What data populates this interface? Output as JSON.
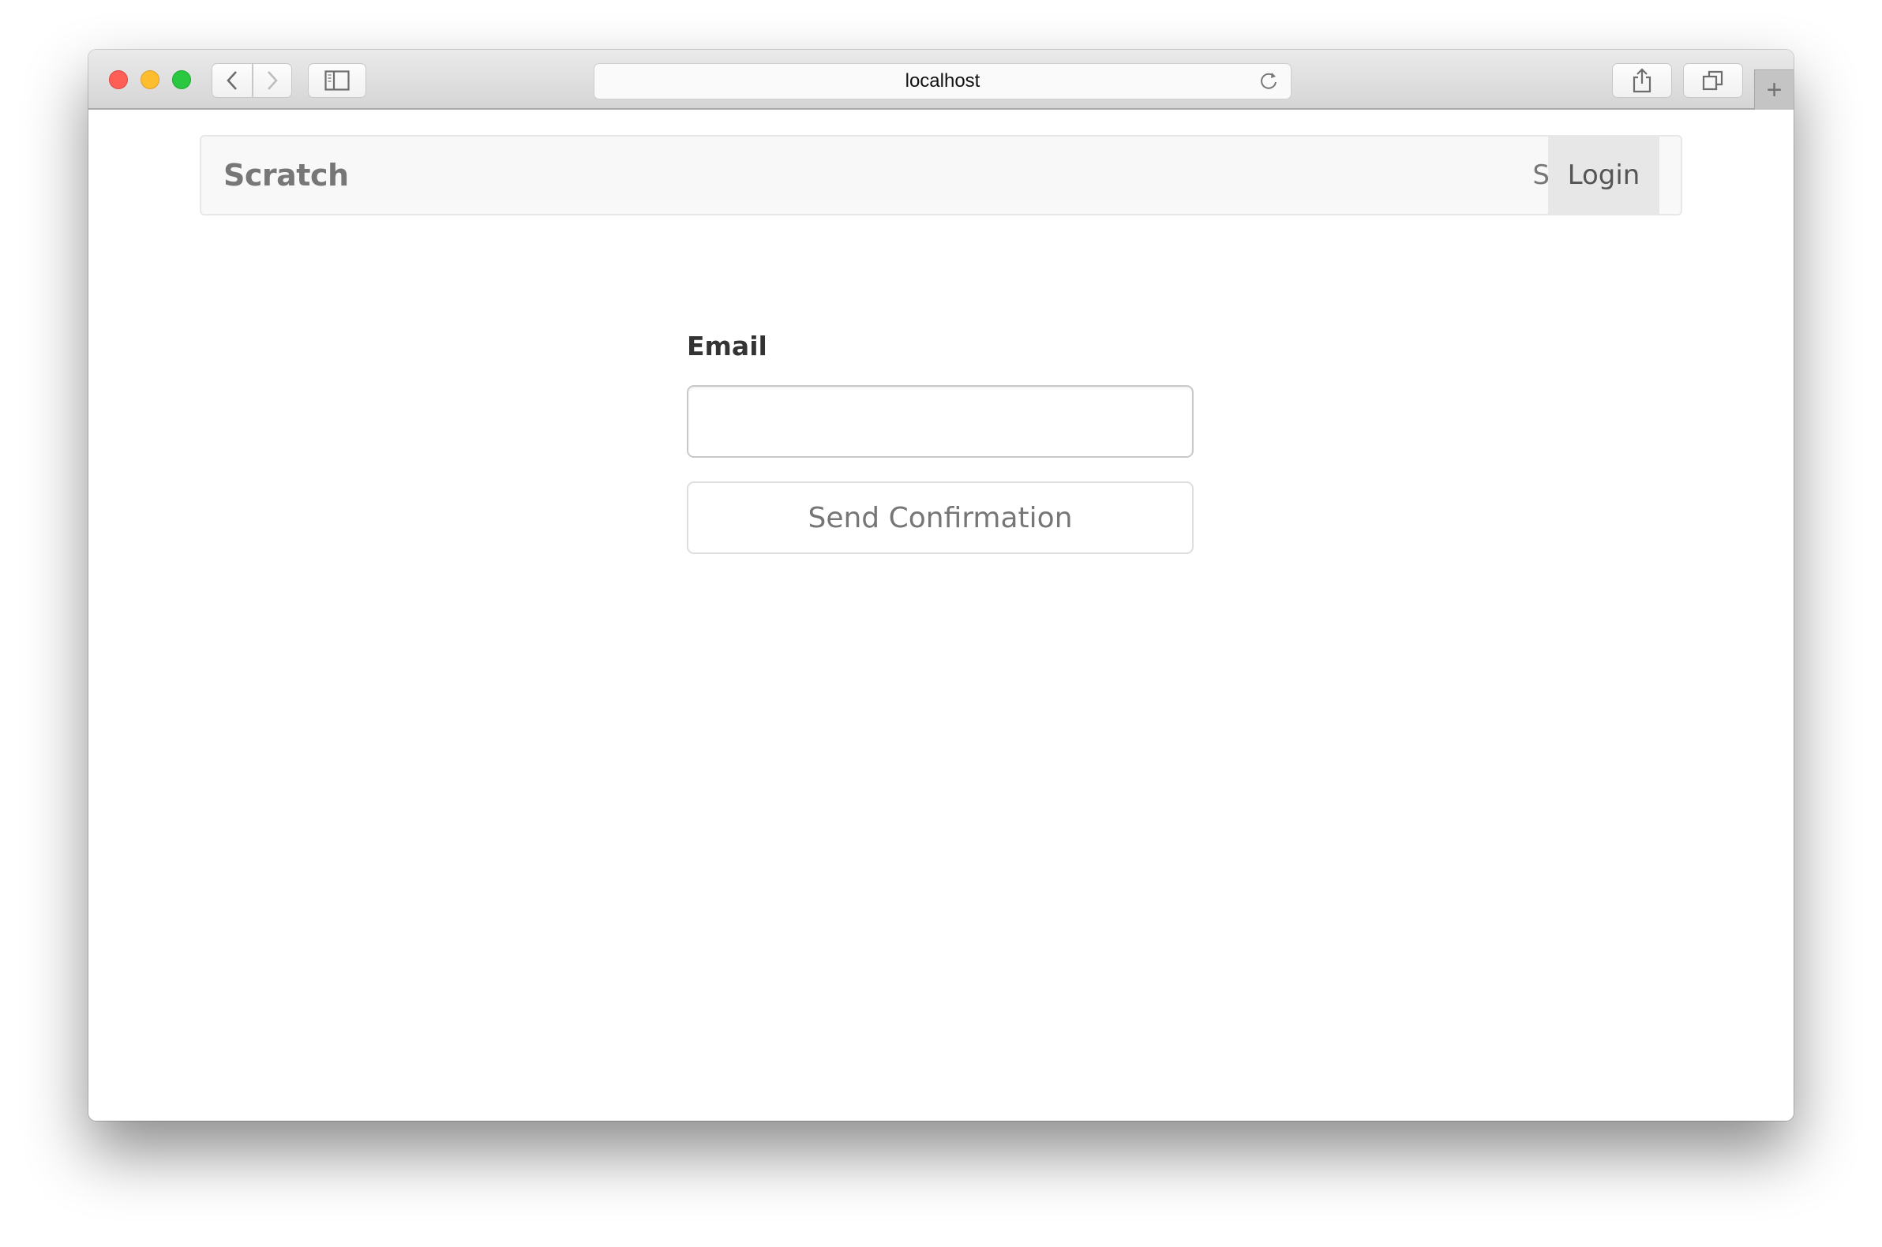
{
  "browser": {
    "url": "localhost",
    "icons": {
      "close": "close-light-icon",
      "minimize": "minimize-light-icon",
      "maximize": "maximize-light-icon",
      "back": "chevron-left-icon",
      "forward": "chevron-right-icon",
      "sidebar": "sidebar-icon",
      "reload": "reload-icon",
      "share": "share-icon",
      "tabs": "tabs-overview-icon",
      "new_tab": "plus-icon"
    },
    "new_tab_glyph": "+"
  },
  "navbar": {
    "brand": "Scratch",
    "items": [
      {
        "label": "Signup",
        "active": false
      },
      {
        "label": "Login",
        "active": true
      }
    ]
  },
  "form": {
    "email_label": "Email",
    "email_value": "",
    "email_placeholder": "",
    "submit_label": "Send Confirmation"
  }
}
